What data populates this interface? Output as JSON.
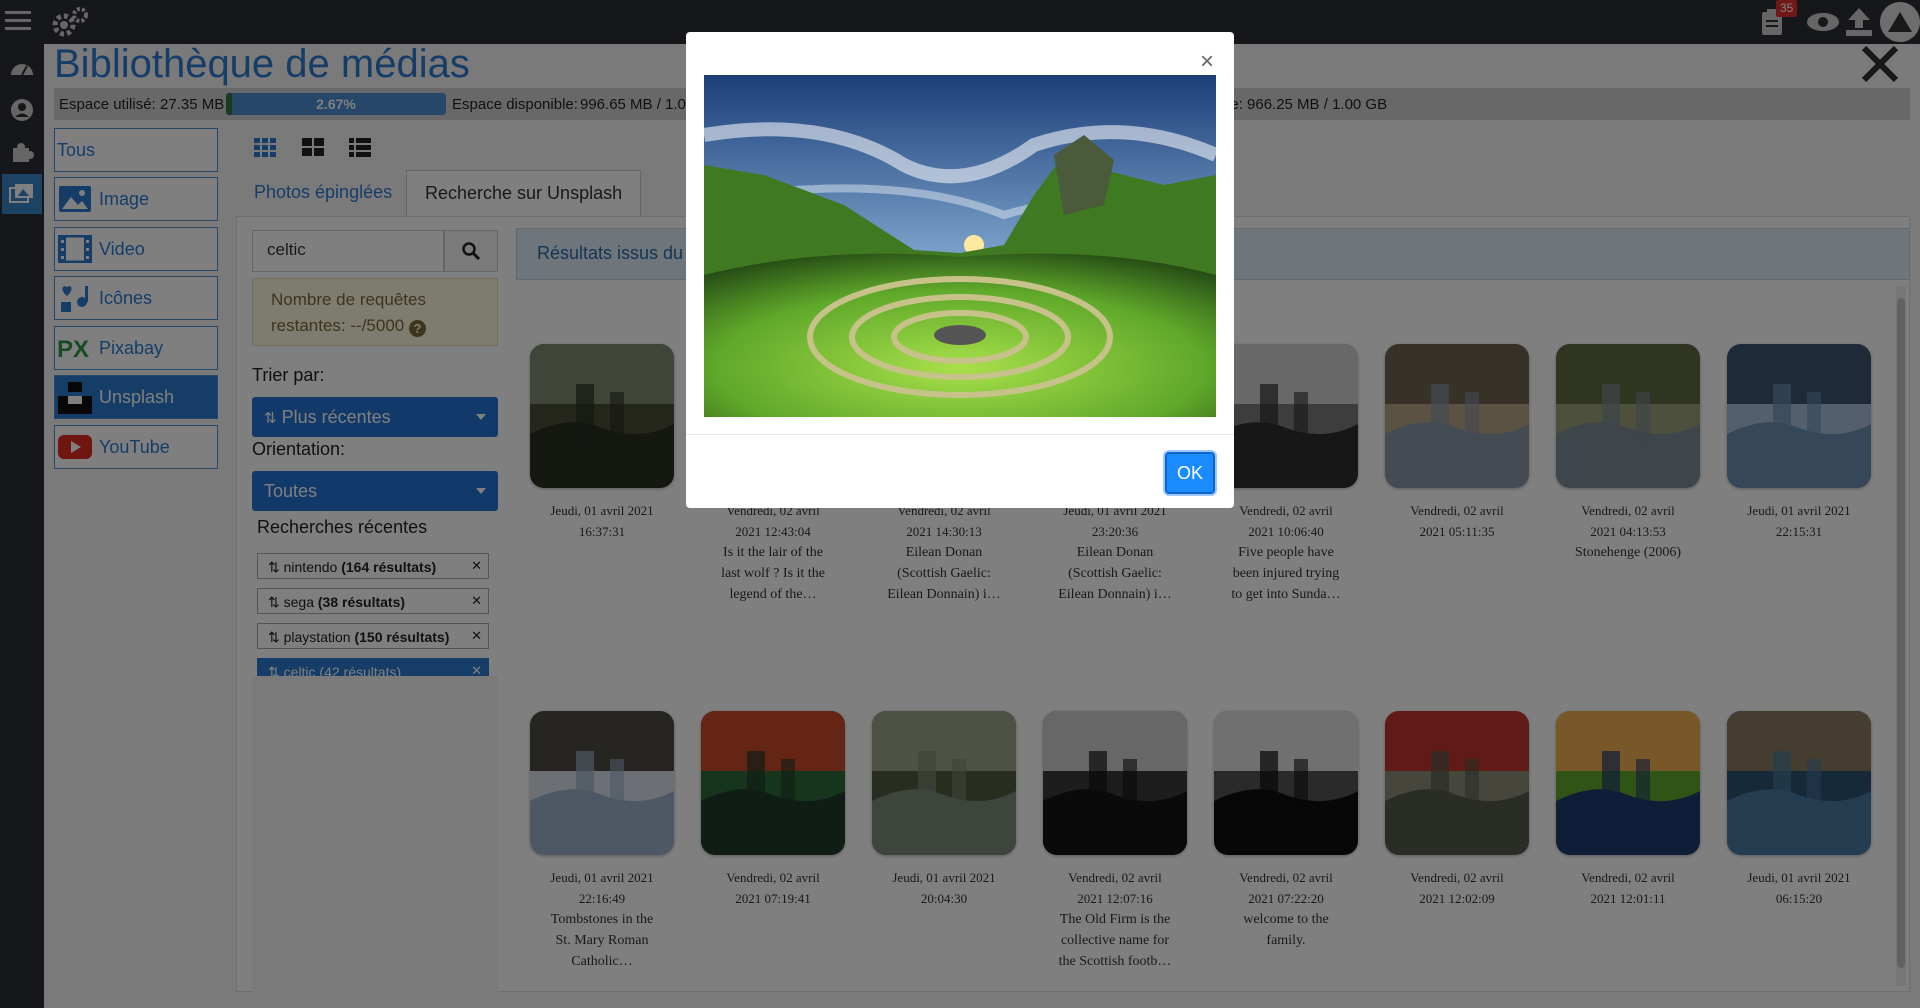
{
  "header": {
    "title": "Bibliothèque de médias",
    "notification_count": "35"
  },
  "quota": {
    "used_label": "Espace utilisé:",
    "used_value": "27.35 MB",
    "percent_label": "2.67%",
    "percent": 2.67,
    "available_label": "Espace disponible:",
    "available_value": "996.65 MB / 1.00",
    "available_tail": "le:   966.25 MB / 1.00 GB"
  },
  "categories": [
    {
      "label": "Tous",
      "icon": "none"
    },
    {
      "label": "Image",
      "icon": "image-icon"
    },
    {
      "label": "Video",
      "icon": "film-icon"
    },
    {
      "label": "Icônes",
      "icon": "icons-icon"
    },
    {
      "label": "Pixabay",
      "icon": "pixabay-icon"
    },
    {
      "label": "Unsplash",
      "icon": "unsplash-icon"
    },
    {
      "label": "YouTube",
      "icon": "youtube-icon"
    }
  ],
  "tabs": {
    "pinned": "Photos épinglées",
    "unsplash": "Recherche sur Unsplash"
  },
  "search": {
    "value": "celtic",
    "placeholder": ""
  },
  "requests": {
    "line1": "Nombre de requêtes",
    "line2": "restantes: --/5000"
  },
  "sort": {
    "label": "Trier par:",
    "value": "Plus récentes"
  },
  "orientation": {
    "label": "Orientation:",
    "value": "Toutes"
  },
  "recent": {
    "title": "Recherches récentes",
    "items": [
      {
        "term": "nintendo",
        "count": "(164 résultats)"
      },
      {
        "term": "sega",
        "count": "(38 résultats)"
      },
      {
        "term": "playstation",
        "count": "(150 résultats)"
      },
      {
        "term": "celtic",
        "count": "(42 résultats)"
      }
    ]
  },
  "results_text": "Résultats issus du",
  "grid": [
    {
      "date1": "Jeudi, 01 avril 2021",
      "date2": "16:37:31",
      "caption": []
    },
    {
      "date1": "Vendredi, 02 avril",
      "date2": "2021 12:43:04",
      "caption": [
        "Is it the lair of the",
        "last wolf ? Is it the",
        "legend of the…"
      ]
    },
    {
      "date1": "Vendredi, 02 avril",
      "date2": "2021 14:30:13",
      "caption": [
        "Eilean Donan",
        "(Scottish Gaelic:",
        "Eilean Donnain) i…"
      ]
    },
    {
      "date1": "Jeudi, 01 avril 2021",
      "date2": "23:20:36",
      "caption": [
        "Eilean Donan",
        "(Scottish Gaelic:",
        "Eilean Donnain) i…"
      ]
    },
    {
      "date1": "Vendredi, 02 avril",
      "date2": "2021 10:06:40",
      "caption": [
        "Five people have",
        "been injured trying",
        "to get into Sunda…"
      ]
    },
    {
      "date1": "Vendredi, 02 avril",
      "date2": "2021 05:11:35",
      "caption": []
    },
    {
      "date1": "Vendredi, 02 avril",
      "date2": "2021 04:13:53",
      "caption": [
        "Stonehenge (2006)"
      ]
    },
    {
      "date1": "Jeudi, 01 avril 2021",
      "date2": "22:15:31",
      "caption": []
    },
    {
      "date1": "Jeudi, 01 avril 2021",
      "date2": "22:16:49",
      "caption": [
        "Tombstones in the",
        "St. Mary Roman",
        "Catholic…"
      ]
    },
    {
      "date1": "Vendredi, 02 avril",
      "date2": "2021 07:19:41",
      "caption": []
    },
    {
      "date1": "Jeudi, 01 avril 2021",
      "date2": "20:04:30",
      "caption": []
    },
    {
      "date1": "Vendredi, 02 avril",
      "date2": "2021 12:07:16",
      "caption": [
        "The Old Firm is the",
        "collective name for",
        "the Scottish footb…"
      ]
    },
    {
      "date1": "Vendredi, 02 avril",
      "date2": "2021 07:22:20",
      "caption": [
        "welcome to the",
        "family."
      ]
    },
    {
      "date1": "Vendredi, 02 avril",
      "date2": "2021 12:02:09",
      "caption": []
    },
    {
      "date1": "Vendredi, 02 avril",
      "date2": "2021 12:01:11",
      "caption": []
    },
    {
      "date1": "Jeudi, 01 avril 2021",
      "date2": "06:15:20",
      "caption": []
    }
  ],
  "modal": {
    "close": "×",
    "ok": "OK"
  },
  "colors": {
    "accent": "#2a7ad1",
    "topbar": "#2b2f36",
    "ok_button": "#1a8cff"
  }
}
